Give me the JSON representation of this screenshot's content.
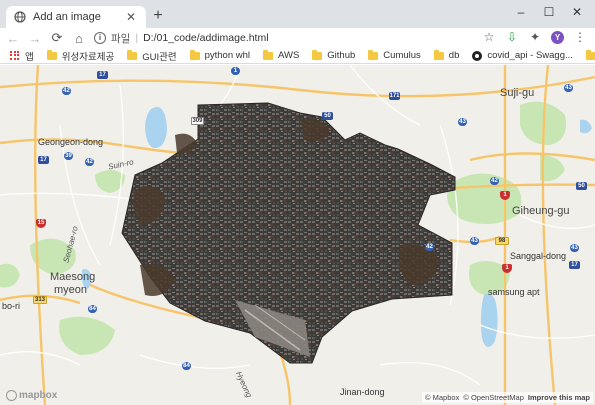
{
  "tab": {
    "title": "Add an image",
    "close_glyph": "✕",
    "favicon_icon": "globe-icon"
  },
  "newtab_glyph": "+",
  "window": {
    "minimize_glyph": "–",
    "maximize_glyph": "☐",
    "close_glyph": "✕"
  },
  "toolbar": {
    "back_glyph": "←",
    "forward_glyph": "→",
    "reload_glyph": "⟳",
    "home_glyph": "⌂",
    "info_glyph": "i",
    "scheme": "파일",
    "url": "D:/01_code/addimage.html",
    "star_glyph": "☆",
    "ext1_glyph": "⇩",
    "ext2_glyph": "✦",
    "avatar_letter": "Y",
    "menu_glyph": "⋮"
  },
  "bookmarks": [
    {
      "label": "앱",
      "icon": "apps-icon"
    },
    {
      "label": "위성자료제공",
      "icon": "folder-icon"
    },
    {
      "label": "GUI관련",
      "icon": "folder-icon"
    },
    {
      "label": "python whl",
      "icon": "folder-icon"
    },
    {
      "label": "AWS",
      "icon": "folder-icon"
    },
    {
      "label": "Github",
      "icon": "folder-icon"
    },
    {
      "label": "Cumulus",
      "icon": "folder-icon"
    },
    {
      "label": "db",
      "icon": "folder-icon"
    },
    {
      "label": "covid_api - Swagg...",
      "icon": "github-icon"
    },
    {
      "label": "tile",
      "icon": "folder-icon"
    }
  ],
  "map": {
    "labels": {
      "suji": "Suji-gu",
      "geongeon": "Geongeon-dong",
      "suinro": "Suin-ro",
      "giheung": "Giheung-gu",
      "sanggal": "Sanggal-dong",
      "maesong": "Maesong",
      "myeon": "myeon",
      "samsung": "samsung apt",
      "jinan": "Jinan-dong",
      "seohaero": "Seohae-ro",
      "hyeong": "Hyeong",
      "bori": "bo-ri"
    },
    "shields": {
      "s17": "17",
      "s1": "1",
      "s171": "171",
      "s50a": "50",
      "s309": "309",
      "s42a": "42",
      "s39": "39",
      "s42b": "42",
      "s17b": "17",
      "s15": "15",
      "s43a": "43",
      "s43b": "43",
      "s42c": "42",
      "s1b": "1",
      "s50b": "50",
      "s42d": "42",
      "s98": "98",
      "s43c": "43",
      "s43d": "43",
      "s1c": "1",
      "s84": "84",
      "s313": "313",
      "s84b": "84",
      "s17c": "17"
    },
    "logo": "mapbox",
    "attribution": [
      "© Mapbox",
      "© OpenStreetMap",
      "Improve this map"
    ]
  },
  "colors": {
    "land": "#f1efe9",
    "water": "#aad3ef",
    "park": "#c8e6b4",
    "highway": "#f6c56a",
    "road": "#ffffff",
    "tabstrip": "#dee1e6"
  }
}
